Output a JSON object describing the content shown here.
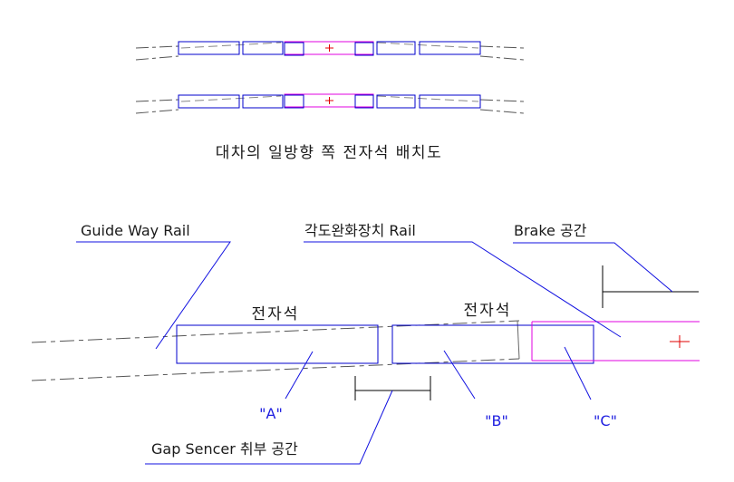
{
  "colors": {
    "magnet_box": "#0000cc",
    "rail": "#e000e0",
    "center_mark": "#e00000",
    "leader": "#1010e0",
    "bracket": "#000000",
    "dash_line": "#555555",
    "callout_text": "#2020e0",
    "text": "#1a1a1a"
  },
  "top_diagram": {
    "caption": "대차의 일방향 쪽 전자석 배치도",
    "rows": 2
  },
  "detail_diagram": {
    "labels": {
      "guide_way_rail": "Guide Way Rail",
      "angle_relief_rail": "각도완화장치 Rail",
      "brake_space": "Brake 공간",
      "magnet_1": "전자석",
      "magnet_2": "전자석",
      "gap_sensor_space": "Gap Sencer 취부 공간"
    },
    "callouts": {
      "a": "\"A\"",
      "b": "\"B\"",
      "c": "\"C\""
    }
  }
}
